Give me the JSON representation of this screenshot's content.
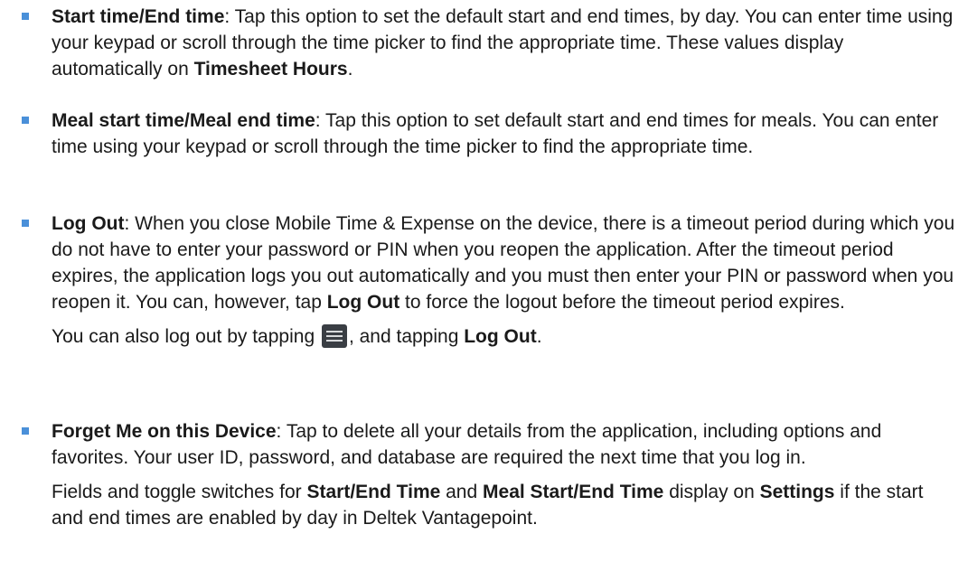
{
  "items": [
    {
      "term": "Start time/End time",
      "desc": ": Tap this option to set the default start and end times, by day. You can enter time using your keypad or scroll through the time picker to find the appropriate time. These values display automatically on ",
      "desc_bold": "Timesheet Hours",
      "desc_end": "."
    },
    {
      "term": "Meal start time/Meal end time",
      "desc": ": Tap this option to set default start and end times for meals. You can enter time using your keypad or scroll through the time picker to find the appropriate time."
    },
    {
      "term": "Log Out",
      "desc": ": When you close Mobile Time & Expense on the device, there is a timeout period during which you do not have to enter your password or PIN when you reopen the application. After the timeout period expires, the application logs you out automatically and you must then enter your PIN or password when you reopen it. You can, however, tap ",
      "desc_bold": "Log Out",
      "desc_end": " to force the logout before the timeout period expires.",
      "note_start": "You can also log out by tapping ",
      "note_icon": "menu-icon",
      "note_mid": ", and tapping ",
      "note_bold": "Log Out",
      "note_end": "."
    },
    {
      "term": "Forget Me on this Device",
      "desc": ": Tap to delete all your details from the application, including options and favorites. Your user ID, password, and database are required the next time that you log in.",
      "note_start": "Fields and toggle switches for ",
      "note_bold1": "Start/End Time",
      "note_mid1": " and ",
      "note_bold2": "Meal Start/End Time",
      "note_mid2": " display on ",
      "note_bold3": "Settings",
      "note_end": " if the start and end times are enabled by day in Deltek Vantagepoint."
    }
  ],
  "colors": {
    "bullet": "#4a90d9",
    "text": "#1a1a1a",
    "icon_bg": "#3a3e44"
  }
}
